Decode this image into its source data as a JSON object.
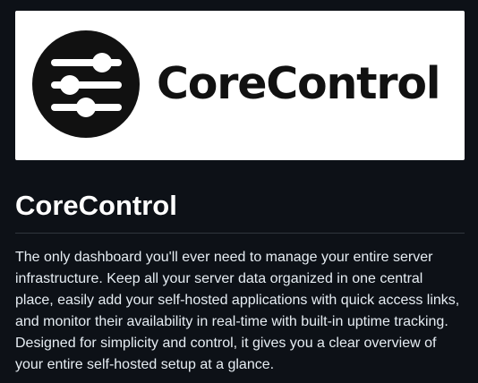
{
  "banner": {
    "logo_icon": "sliders-icon",
    "logo_text": "CoreControl",
    "background_color": "#ffffff",
    "text_color": "#111111"
  },
  "header": {
    "title": "CoreControl"
  },
  "description": {
    "text": "The only dashboard you'll ever need to manage your entire server infrastructure. Keep all your server data organized in one central place, easily add your self-hosted applications with quick access links, and monitor their availability in real-time with built-in uptime tracking. Designed for simplicity and control, it gives you a clear overview of your entire self-hosted setup at a glance."
  },
  "theme": {
    "page_background": "#0d1117",
    "text_color": "#e6edf3",
    "divider_color": "#30363d"
  }
}
